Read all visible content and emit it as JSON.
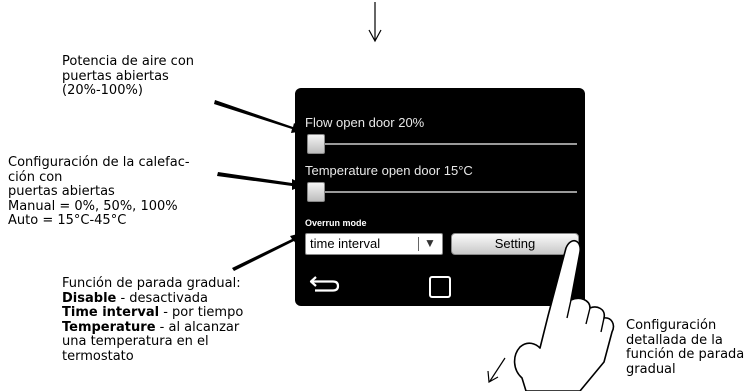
{
  "annotations": {
    "air_power": [
      "Potencia de aire con",
      "puertas abiertas",
      "(20%-100%)"
    ],
    "heating": [
      "Configuración de la calefac-",
      "ción con",
      "puertas abiertas",
      "Manual = 0%, 50%, 100%",
      "Auto = 15°C-45°C"
    ],
    "stop_title": "Función de parada gradual:",
    "stop_items": [
      {
        "key": "Disable",
        "desc": " - desactivada"
      },
      {
        "key": "Time interval",
        "desc": " - por tiempo"
      },
      {
        "key": "Temperature",
        "desc": " - al alcanzar"
      }
    ],
    "stop_tail": [
      "una temperatura en el",
      "termostato"
    ],
    "setting_detail": [
      "Configuración",
      "detallada de la",
      "función de parada",
      "gradual"
    ]
  },
  "screen": {
    "flow_label": "Flow open door 20%",
    "flow_level": 0.2,
    "temp_label": "Temperature open door 15°C",
    "temp_level": 0.15,
    "overrun_label": "Overrun mode",
    "overrun_value": "time interval",
    "setting_button": "Setting"
  },
  "icons": {
    "back": "back-arrow-icon",
    "home": "home-square-icon",
    "hand": "pointing-hand-icon",
    "caret": "dropdown-caret-icon"
  }
}
